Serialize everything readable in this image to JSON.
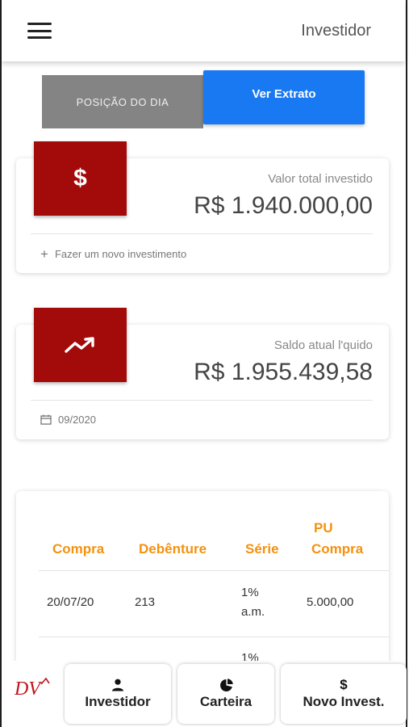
{
  "header": {
    "title": "Investidor",
    "menu_icon": "hamburger-menu-icon"
  },
  "tabs": {
    "posicao": "POSIÇÃO DO DIA",
    "extrato": "Ver Extrato"
  },
  "cards": [
    {
      "icon": "dollar-icon",
      "label": "Valor total investido",
      "value": "R$ 1.940.000,00",
      "footer": "Fazer um novo investimento",
      "footer_icon": "plus-icon"
    },
    {
      "icon": "trending-up-icon",
      "label": "Saldo atual l'quido",
      "value": "R$ 1.955.439,58",
      "footer": "09/2020",
      "footer_icon": "calendar-icon"
    }
  ],
  "table": {
    "headers": {
      "compra": "Compra",
      "debenture": "Debênture",
      "serie": "Série",
      "pu_line1": "PU",
      "pu_line2": "Compra"
    },
    "rows": [
      {
        "compra": "20/07/20",
        "debenture": "213",
        "serie_line1": "1%",
        "serie_line2": "a.m.",
        "pu": "5.000,00"
      },
      {
        "compra": "",
        "debenture": "",
        "serie_line1": "1%",
        "serie_line2": "",
        "pu": ""
      }
    ]
  },
  "bottom_nav": {
    "logo": "DV",
    "items": [
      {
        "label": "Investidor",
        "icon": "person-icon"
      },
      {
        "label": "Carteira",
        "icon": "pie-chart-icon"
      },
      {
        "label": "Novo Invest.",
        "icon": "$"
      }
    ]
  },
  "colors": {
    "primary_blue": "#1979f2",
    "accent_red": "#a30b0b",
    "header_orange": "#f3920f",
    "tab_gray": "#848484"
  }
}
